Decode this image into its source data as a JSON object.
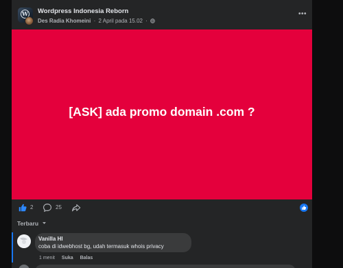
{
  "post": {
    "group_name": "Wordpress Indonesia Reborn",
    "author": "Des Radia Khomeini",
    "separator": "·",
    "timestamp": "2 April pada 15.02",
    "more_label": "•••",
    "group_avatar_letter": "W"
  },
  "banner": {
    "text": "[ASK] ada promo domain .com ?",
    "color": "#e4003c"
  },
  "reactions": {
    "like_count": "2",
    "comment_count": "25"
  },
  "comments_sort": {
    "label": "Terbaru"
  },
  "comment": {
    "author": "Vanilla HI",
    "text": "coba di idwebhost bg, udah termasuk whois privacy",
    "time": "1 menit",
    "like_label": "Suka",
    "reply_label": "Balas"
  },
  "colors": {
    "accent": "#1877f2",
    "card_bg": "#242526",
    "bubble_bg": "#3a3b3c"
  }
}
